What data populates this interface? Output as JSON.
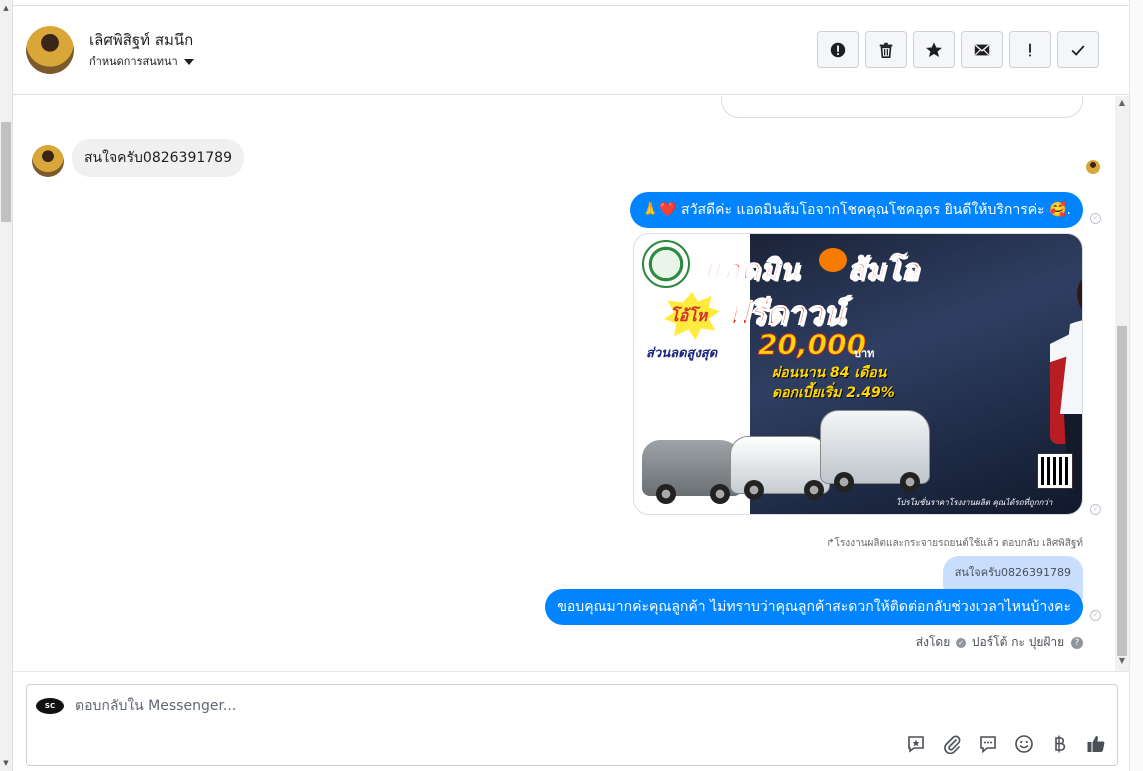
{
  "header": {
    "contact_name": "เลิศพิสิฐท์ สมนึก",
    "subtitle": "กำหนดการสนทนา"
  },
  "toolbar": {
    "spam": "spam-icon",
    "delete": "trash-icon",
    "star": "star-icon",
    "unread": "envelope-icon",
    "important": "exclamation-icon",
    "done": "check-icon"
  },
  "messages": {
    "incoming_1": "สนใจครับ0826391789",
    "outgoing_1": "🙏❤️ สวัสดีค่ะ แอดมินส้มโอจากโชคคุณโชคอุดร ยินดีให้บริการค่ะ 🥰.",
    "reply_note": "↱โรงงานผลิตและกระจายรถยนต์ใช้แล้ว ตอบกลับ เลิศพิสิฐท์",
    "quoted_text": "สนใจครับ0826391789",
    "outgoing_2": "ขอบคุณมากค่ะคุณลูกค้า ไม่ทราบว่าคุณลูกค้าสะดวกให้ติดต่อกลับช่วงเวลาไหนบ้างคะ",
    "sent_by_label": "ส่งโดย",
    "sent_by_name": "ปอร์โต้ กะ ปุยฝ้าย"
  },
  "ad": {
    "title_left": "แอดมิน",
    "title_right": "ส้มโอ",
    "burst": "โอ้โห",
    "headline": "ฟรีดาวน์",
    "discount_label": "ส่วนลดสูงสุด",
    "discount_amount": "20,000",
    "currency": "บาท",
    "installment": "ผ่อนนาน 84 เดือน",
    "interest": "ดอกเบี้ยเริ่ม 2.49%",
    "footer": "โปรโมชั่นราคาโรงงานผลิต คุณได้รถที่ถูกกว่า"
  },
  "composer": {
    "placeholder": "ตอบกลับใน Messenger...",
    "brand_logo_text": "SC"
  },
  "colors": {
    "outgoing_bubble": "#0084ff",
    "incoming_bubble": "#f0f0f0",
    "quote_bubble": "#c9ddfc"
  }
}
